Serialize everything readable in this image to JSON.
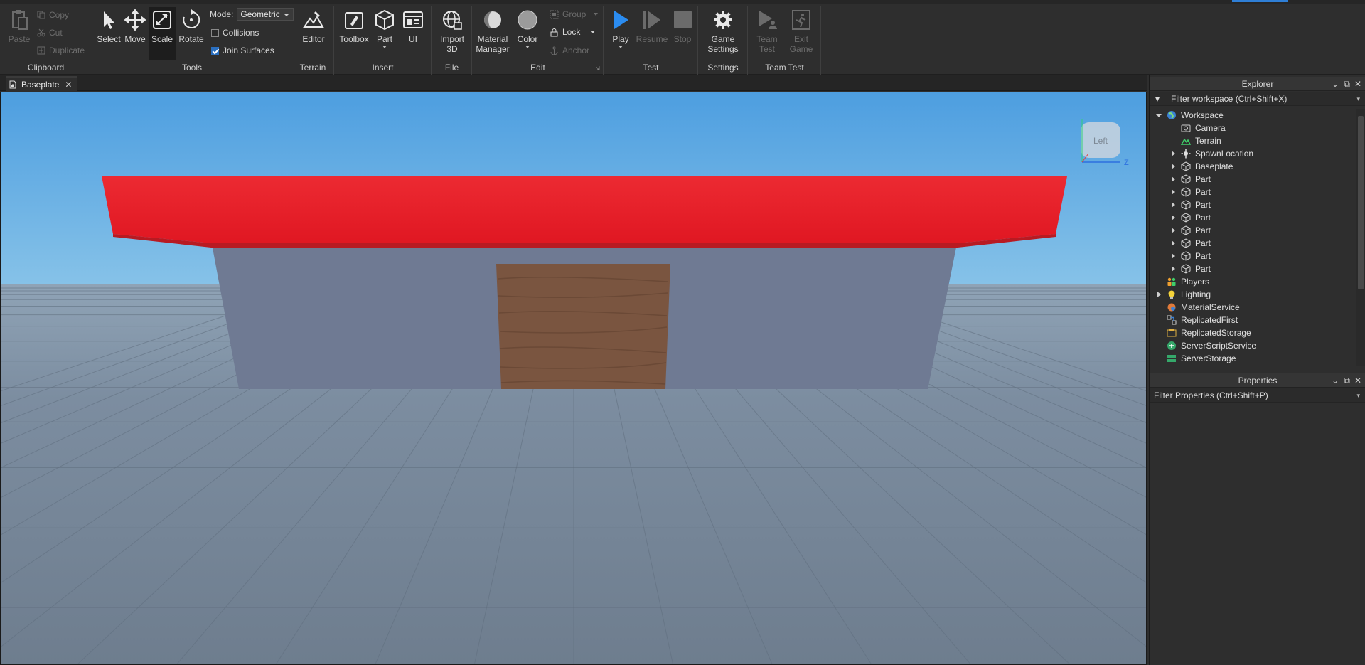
{
  "ribbon": {
    "clipboard": {
      "label": "Clipboard",
      "paste": "Paste",
      "copy": "Copy",
      "cut": "Cut",
      "duplicate": "Duplicate"
    },
    "tools": {
      "label": "Tools",
      "select": "Select",
      "move": "Move",
      "scale": "Scale",
      "rotate": "Rotate",
      "mode_label": "Mode:",
      "mode_value": "Geometric",
      "collisions": "Collisions",
      "collisions_checked": false,
      "join_surfaces": "Join Surfaces",
      "join_surfaces_checked": true
    },
    "terrain": {
      "label": "Terrain",
      "editor": "Editor"
    },
    "insert": {
      "label": "Insert",
      "toolbox": "Toolbox",
      "part": "Part",
      "ui": "UI"
    },
    "file": {
      "label": "File",
      "import_line1": "Import",
      "import_line2": "3D"
    },
    "edit": {
      "label": "Edit",
      "material_line1": "Material",
      "material_line2": "Manager",
      "color": "Color",
      "group": "Group",
      "lock": "Lock",
      "anchor": "Anchor"
    },
    "test": {
      "label": "Test",
      "play": "Play",
      "resume": "Resume",
      "stop": "Stop"
    },
    "settings": {
      "label": "Settings",
      "game_line1": "Game",
      "game_line2": "Settings"
    },
    "teamtest": {
      "label": "Team Test",
      "team_line1": "Team",
      "team_line2": "Test",
      "exit_line1": "Exit",
      "exit_line2": "Game"
    }
  },
  "tab": {
    "title": "Baseplate"
  },
  "viewport": {
    "view_cube_label": "Left",
    "axis_z": "Z",
    "roof_color": "#e41c28",
    "wall_color": "#6f7a93",
    "door_color": "#7a5540",
    "sky_top": "#4d9ee0",
    "sky_bottom": "#86c2e8"
  },
  "explorer": {
    "title": "Explorer",
    "filter_placeholder": "Filter workspace (Ctrl+Shift+X)",
    "items": [
      {
        "label": "Workspace",
        "icon": "globe-icon",
        "toggle": "open",
        "depth": 0
      },
      {
        "label": "Camera",
        "icon": "camera-icon",
        "toggle": "none",
        "depth": 1
      },
      {
        "label": "Terrain",
        "icon": "terrain-icon",
        "toggle": "none",
        "depth": 1
      },
      {
        "label": "SpawnLocation",
        "icon": "spawn-icon",
        "toggle": "closed",
        "depth": 1
      },
      {
        "label": "Baseplate",
        "icon": "part-icon",
        "toggle": "closed",
        "depth": 1
      },
      {
        "label": "Part",
        "icon": "part-icon",
        "toggle": "closed",
        "depth": 1
      },
      {
        "label": "Part",
        "icon": "part-icon",
        "toggle": "closed",
        "depth": 1
      },
      {
        "label": "Part",
        "icon": "part-icon",
        "toggle": "closed",
        "depth": 1
      },
      {
        "label": "Part",
        "icon": "part-icon",
        "toggle": "closed",
        "depth": 1
      },
      {
        "label": "Part",
        "icon": "part-icon",
        "toggle": "closed",
        "depth": 1
      },
      {
        "label": "Part",
        "icon": "part-icon",
        "toggle": "closed",
        "depth": 1
      },
      {
        "label": "Part",
        "icon": "part-icon",
        "toggle": "closed",
        "depth": 1
      },
      {
        "label": "Part",
        "icon": "part-icon",
        "toggle": "closed",
        "depth": 1
      },
      {
        "label": "Players",
        "icon": "players-icon",
        "toggle": "none",
        "depth": 0
      },
      {
        "label": "Lighting",
        "icon": "lightbulb-icon",
        "toggle": "closed",
        "depth": 0
      },
      {
        "label": "MaterialService",
        "icon": "material-service-icon",
        "toggle": "none",
        "depth": 0
      },
      {
        "label": "ReplicatedFirst",
        "icon": "replicated-first-icon",
        "toggle": "none",
        "depth": 0
      },
      {
        "label": "ReplicatedStorage",
        "icon": "replicated-storage-icon",
        "toggle": "none",
        "depth": 0
      },
      {
        "label": "ServerScriptService",
        "icon": "server-script-icon",
        "toggle": "none",
        "depth": 0
      },
      {
        "label": "ServerStorage",
        "icon": "server-storage-icon",
        "toggle": "none",
        "depth": 0
      }
    ]
  },
  "properties": {
    "title": "Properties",
    "filter_placeholder": "Filter Properties (Ctrl+Shift+P)"
  }
}
